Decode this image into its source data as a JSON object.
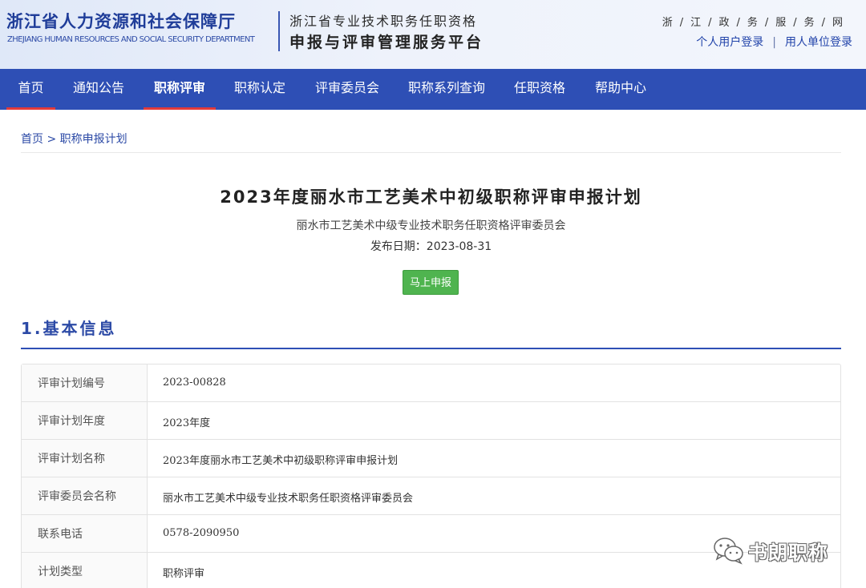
{
  "header": {
    "brand_cn": "浙江省人力资源和社会保障厅",
    "brand_en": "ZHEJIANG HUMAN RESOURCES AND SOCIAL SECURITY DEPARTMENT",
    "platform_top": "浙江省专业技术职务任职资格",
    "platform_main": "申报与评审管理服务平台",
    "gov_link": "浙/江/政/务/服/务/网",
    "personal_login": "个人用户登录",
    "separator": "|",
    "employer_login": "用人单位登录"
  },
  "nav": {
    "items": [
      {
        "label": "首页"
      },
      {
        "label": "通知公告"
      },
      {
        "label": "职称评审"
      },
      {
        "label": "职称认定"
      },
      {
        "label": "评审委员会"
      },
      {
        "label": "职称系列查询"
      },
      {
        "label": "任职资格"
      },
      {
        "label": "帮助中心"
      }
    ],
    "active_index": 2
  },
  "breadcrumb": {
    "home": "首页",
    "sep": " > ",
    "current": "职称申报计划"
  },
  "document": {
    "title": "2023年度丽水市工艺美术中初级职称评审申报计划",
    "committee": "丽水市工艺美术中级专业技术职务任职资格评审委员会",
    "publish_date": "发布日期：2023-08-31",
    "apply_button": "马上申报"
  },
  "section": {
    "title": "1.基本信息"
  },
  "info_rows": [
    {
      "label": "评审计划编号",
      "value": "2023-00828"
    },
    {
      "label": "评审计划年度",
      "value": "2023年度"
    },
    {
      "label": "评审计划名称",
      "value": "2023年度丽水市工艺美术中初级职称评审申报计划"
    },
    {
      "label": "评审委员会名称",
      "value": "丽水市工艺美术中级专业技术职务任职资格评审委员会"
    },
    {
      "label": "联系电话",
      "value": "0578-2090950"
    },
    {
      "label": "计划类型",
      "value": "职称评审"
    }
  ],
  "watermark": {
    "text": "书朗职称",
    "icon": "wechat-icon"
  },
  "colors": {
    "nav_bg": "#2e4fb5",
    "brand_blue": "#1f3d99",
    "active_underline": "#e33a3a",
    "apply_green": "#4fb44f"
  }
}
